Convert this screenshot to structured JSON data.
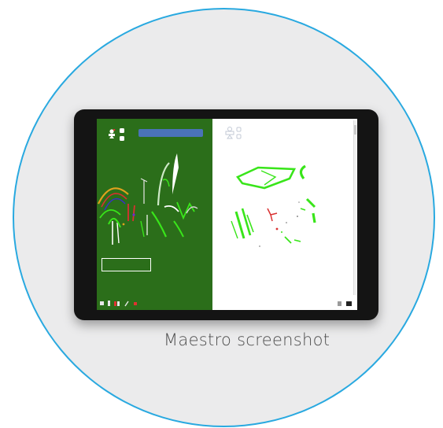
{
  "caption": "Maestro screenshot",
  "colors": {
    "frame_circle": "#29a9e0",
    "tablet_bezel": "#141414",
    "left_pane_background": "#2b6e1a",
    "search_bar": "#4a73b8",
    "drawing_green": "#39e51a"
  },
  "app": {
    "left_pane": {
      "search_bar": {
        "text": ""
      },
      "info_box": {
        "line1": "",
        "line2": ""
      }
    },
    "icons": {
      "left_top": "tool-icons",
      "right_top": "tool-icons",
      "bottom_left": "toolbar-icons",
      "bottom_right": "toolbar-icons"
    }
  }
}
